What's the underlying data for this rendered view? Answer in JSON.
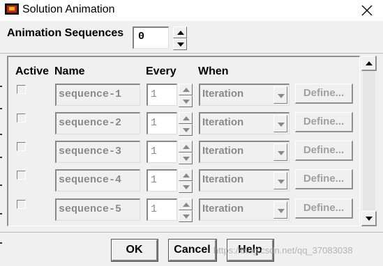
{
  "window": {
    "title": "Solution Animation",
    "close_icon": "close-icon",
    "app_icon": "fluent-app-icon"
  },
  "header": {
    "sequences_label": "Animation Sequences",
    "sequences_value": "0"
  },
  "table": {
    "columns": {
      "active": "Active",
      "name": "Name",
      "every": "Every",
      "when": "When"
    },
    "rows": [
      {
        "active": false,
        "name": "sequence-1",
        "every": "1",
        "when": "Iteration",
        "define": "Define..."
      },
      {
        "active": false,
        "name": "sequence-2",
        "every": "1",
        "when": "Iteration",
        "define": "Define..."
      },
      {
        "active": false,
        "name": "sequence-3",
        "every": "1",
        "when": "Iteration",
        "define": "Define..."
      },
      {
        "active": false,
        "name": "sequence-4",
        "every": "1",
        "when": "Iteration",
        "define": "Define..."
      },
      {
        "active": false,
        "name": "sequence-5",
        "every": "1",
        "when": "Iteration",
        "define": "Define..."
      }
    ]
  },
  "buttons": {
    "ok": "OK",
    "cancel": "Cancel",
    "help": "Help"
  },
  "watermark": "https://blog.csdn.net/qq_37083038",
  "colors": {
    "window_bg": "#f0f0f0",
    "disabled_text": "#8a8a8a",
    "title_bg": "#ffffff"
  }
}
